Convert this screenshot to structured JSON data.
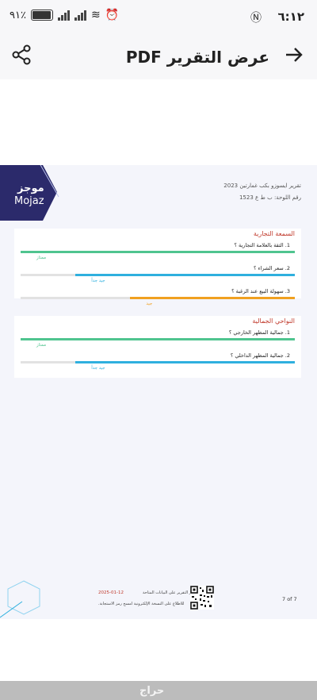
{
  "status_bar": {
    "time": "٦:١٢",
    "battery_text": "٩١٪",
    "battery_level": 0.91
  },
  "app_bar": {
    "title": "عرض التقرير PDF",
    "back_icon": "arrow-right-icon",
    "share_icon": "share-icon"
  },
  "report": {
    "logo_arabic": "موجز",
    "logo_english": "Mojaz",
    "title": "تقرير ايسوزو بكب غمارتين 2023",
    "plate": "رقم اللوحة:     ب ط ع 1523",
    "sections": [
      {
        "title": "السمعة التجارية",
        "questions": [
          {
            "text": "1. الثقة بالعلامة التجارية ؟",
            "rating": "ممتاز",
            "score": 1.0,
            "color": "#4fc48f"
          },
          {
            "text": "2. سعر الشراء ؟",
            "rating": "جيد جداً",
            "score": 0.8,
            "color": "#2fb0de"
          },
          {
            "text": "3. سهولة البيع عند الرغبة ؟",
            "rating": "جيد",
            "score": 0.6,
            "color": "#f0a020"
          }
        ]
      },
      {
        "title": "النواحي الجمالية",
        "questions": [
          {
            "text": "1. جمالية المظهر الخارجي ؟",
            "rating": "ممتاز",
            "score": 1.0,
            "color": "#4fc48f"
          },
          {
            "text": "2. جمالية المظهر الداخلي ؟",
            "rating": "جيد جداً",
            "score": 0.8,
            "color": "#2fb0de"
          }
        ]
      }
    ],
    "footer": {
      "issue_note": "تم إصدار التقرير على البيانات المتاحة",
      "date": "2025-01-12",
      "scan_note": "للاطلاع على النسخة الإلكترونية امسح رمز الاستجابة.",
      "page_number": "7   of 7"
    }
  },
  "nav_bar": {
    "watermark": "حراج"
  }
}
